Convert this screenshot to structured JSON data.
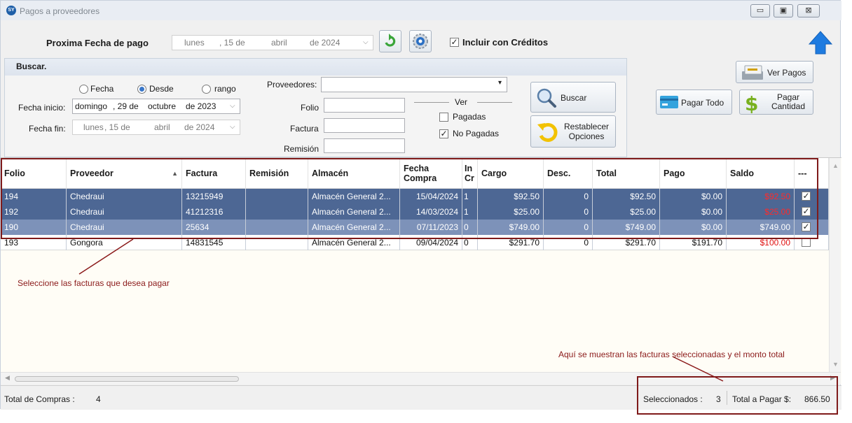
{
  "window": {
    "title": "Pagos a proveedores",
    "app_badge": "SY",
    "minimize": "▭",
    "maximize": "▣",
    "close": "⊠"
  },
  "top": {
    "next_date_label": "Proxima Fecha de pago",
    "next_date_weekday": "lunes",
    "next_date_day": ", 15 de",
    "next_date_month": "abril",
    "next_date_year": "de 2024",
    "include_credits_label": "Incluir con Créditos",
    "include_credits_checked": true
  },
  "search": {
    "title": "Buscar.",
    "radio_fecha": "Fecha",
    "radio_desde": "Desde",
    "radio_rango": "rango",
    "selected_radio": "Desde",
    "start_label": "Fecha inicio:",
    "start_weekday": "domingo",
    "start_day": ", 29 de",
    "start_month": "octubre",
    "start_year": "de 2023",
    "end_label": "Fecha fin:",
    "end_weekday": "lunes",
    "end_day": ", 15 de",
    "end_month": "abril",
    "end_year": "de 2024",
    "proveedores_label": "Proveedores:",
    "proveedores_value": "",
    "folio_label": "Folio",
    "factura_label": "Factura",
    "remision_label": "Remisión",
    "ver_label": "Ver",
    "pagadas_label": "Pagadas",
    "pagadas_checked": false,
    "no_pagadas_label": "No Pagadas",
    "no_pagadas_checked": true,
    "buscar_button": "Buscar",
    "restablecer_line1": "Restablecer",
    "restablecer_line2": "Opciones"
  },
  "actions": {
    "ver_pagos": "Ver Pagos",
    "pagar_todo": "Pagar Todo",
    "pagar_cantidad_line1": "Pagar",
    "pagar_cantidad_line2": "Cantidad"
  },
  "table": {
    "headers": {
      "folio": "Folio",
      "proveedor": "Proveedor",
      "factura": "Factura",
      "remision": "Remisión",
      "almacen": "Almacén",
      "fecha_line1": "Fecha",
      "fecha_line2": "Compra",
      "in_line1": "In",
      "in_line2": "Cr",
      "cargo": "Cargo",
      "desc": "Desc.",
      "total": "Total",
      "pago": "Pago",
      "saldo": "Saldo",
      "check": "---"
    },
    "rows": [
      {
        "folio": "194",
        "proveedor": "Chedraui",
        "factura": "13215949",
        "remision": "",
        "almacen": "Almacén General 2...",
        "fecha": "15/04/2024",
        "in": "1",
        "cargo": "$92.50",
        "desc": "0",
        "total": "$92.50",
        "pago": "$0.00",
        "saldo": "$92.50",
        "checked": true
      },
      {
        "folio": "192",
        "proveedor": "Chedraui",
        "factura": "41212316",
        "remision": "",
        "almacen": "Almacén General 2...",
        "fecha": "14/03/2024",
        "in": "1",
        "cargo": "$25.00",
        "desc": "0",
        "total": "$25.00",
        "pago": "$0.00",
        "saldo": "$25.00",
        "checked": true
      },
      {
        "folio": "190",
        "proveedor": "Chedraui",
        "factura": "25634",
        "remision": "",
        "almacen": "Almacén General 2...",
        "fecha": "07/11/2023",
        "in": "0",
        "cargo": "$749.00",
        "desc": "0",
        "total": "$749.00",
        "pago": "$0.00",
        "saldo": "$749.00",
        "checked": true
      },
      {
        "folio": "193",
        "proveedor": "Gongora",
        "factura": "14831545",
        "remision": "",
        "almacen": "Almacén General 2...",
        "fecha": "09/04/2024",
        "in": "0",
        "cargo": "$291.70",
        "desc": "0",
        "total": "$291.70",
        "pago": "$191.70",
        "saldo": "$100.00",
        "checked": false
      }
    ]
  },
  "annotations": {
    "select_note": "Seleccione las facturas que desea pagar",
    "total_note": "Aquí se muestran las facturas seleccionadas y el monto total"
  },
  "status": {
    "total_compras_label": "Total de  Compras :",
    "total_compras_value": "4",
    "seleccionados_label": "Seleccionados :",
    "seleccionados_value": "3",
    "total_pagar_label": "Total a Pagar $:",
    "total_pagar_value": "866.50"
  }
}
